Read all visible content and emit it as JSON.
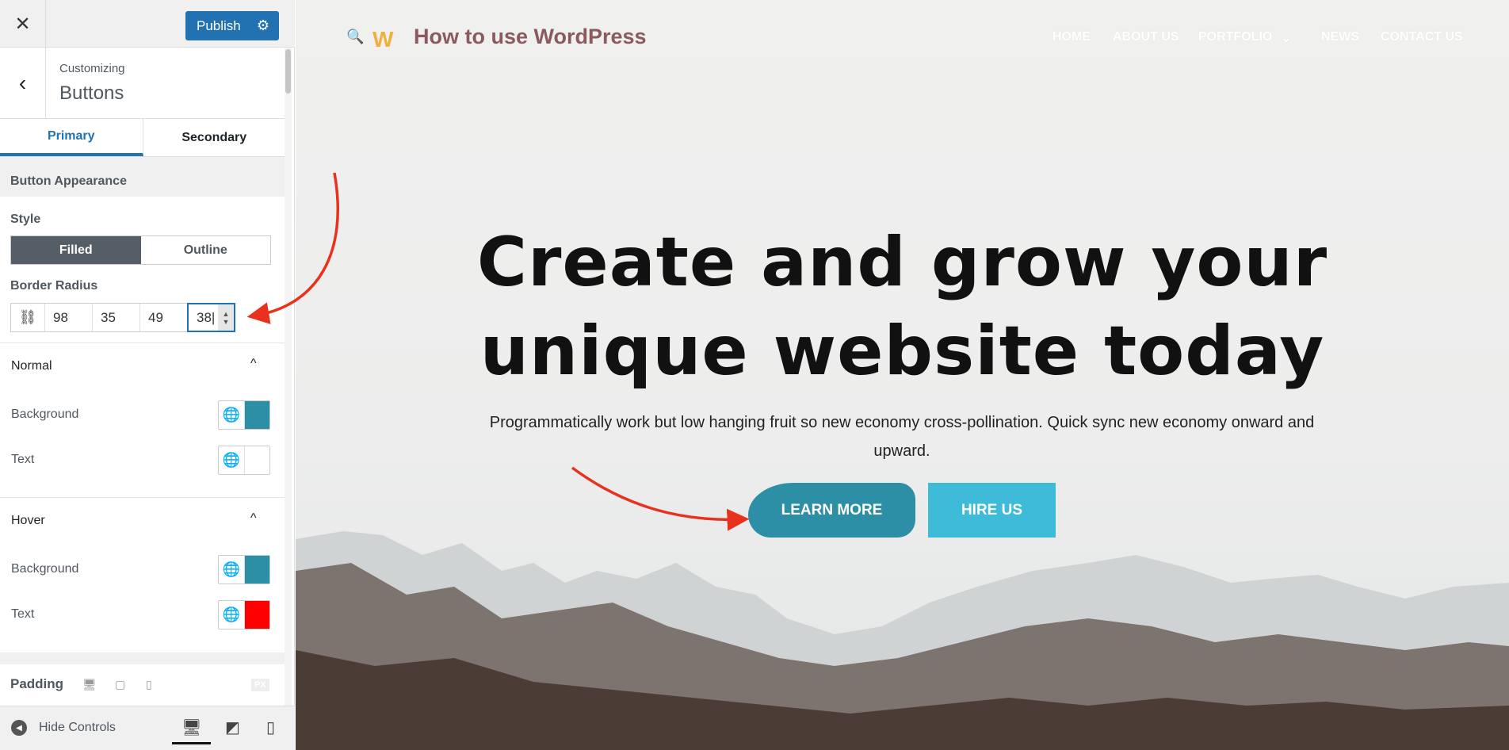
{
  "sidebar": {
    "publish_label": "Publish",
    "customizing_label": "Customizing",
    "section_title": "Buttons",
    "tabs": [
      {
        "label": "Primary",
        "active": true
      },
      {
        "label": "Secondary",
        "active": false
      }
    ],
    "appearance_heading": "Button Appearance",
    "style_label": "Style",
    "style_options": [
      {
        "label": "Filled",
        "selected": true
      },
      {
        "label": "Outline",
        "selected": false
      }
    ],
    "border_radius_label": "Border Radius",
    "border_radius": [
      "98",
      "35",
      "49",
      "38"
    ],
    "normal": {
      "title": "Normal",
      "background_label": "Background",
      "background_color": "#2d8fa5",
      "text_label": "Text",
      "text_color": "#ffffff"
    },
    "hover": {
      "title": "Hover",
      "background_label": "Background",
      "background_color": "#2d8fa5",
      "text_label": "Text",
      "text_color": "#ff0000"
    },
    "padding_label": "Padding",
    "padding_unit": "PX",
    "hide_controls_label": "Hide Controls"
  },
  "preview": {
    "site_title": "How to use WordPress",
    "nav": [
      "HOME",
      "ABOUT US",
      "PORTFOLIO",
      "NEWS",
      "CONTACT US"
    ],
    "heading_line1": "Create and grow your",
    "heading_line2": "unique website today",
    "paragraph": "Programmatically work but low hanging fruit so new economy cross-pollination. Quick sync new economy onward and upward.",
    "primary_button": "LEARN MORE",
    "secondary_button": "HIRE US"
  },
  "colors": {
    "accent": "#2271b1",
    "primary_button": "#2d8fa5",
    "secondary_button": "#3dbbd9",
    "annotation_arrow": "#e8321e"
  }
}
